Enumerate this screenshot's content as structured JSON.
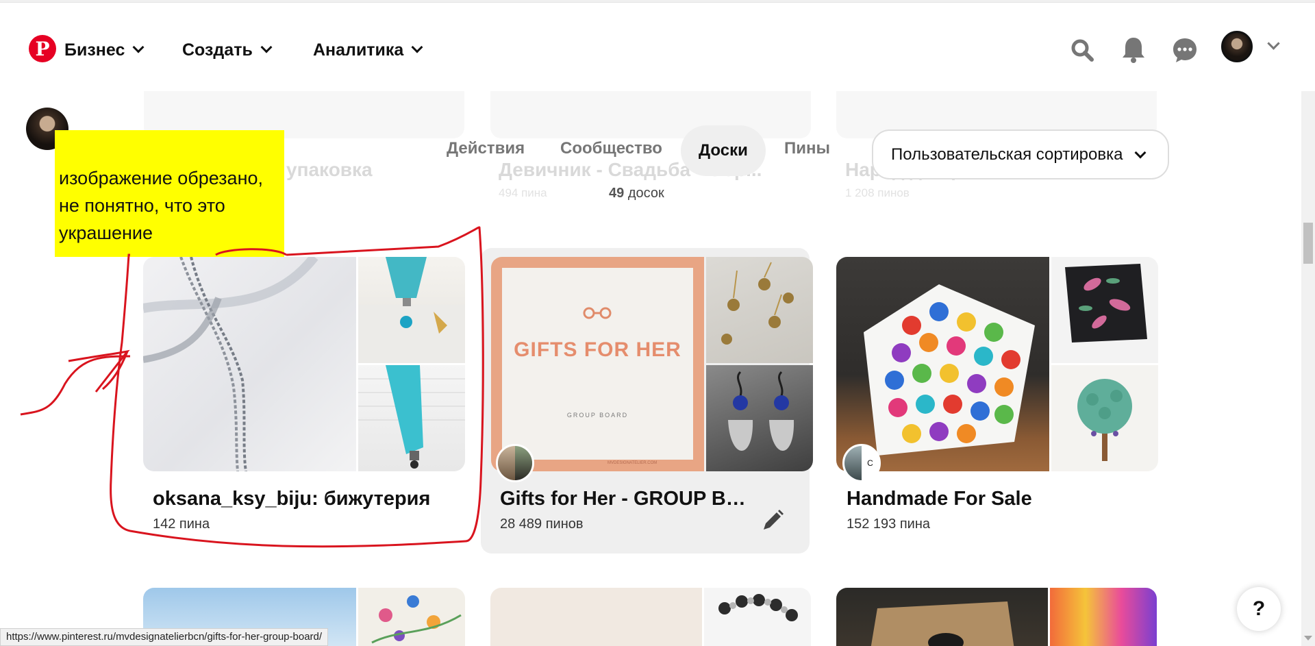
{
  "header": {
    "logo_letter": "P",
    "nav": [
      {
        "label": "Бизнес"
      },
      {
        "label": "Создать"
      },
      {
        "label": "Аналитика"
      }
    ],
    "icons": [
      "search-icon",
      "bell-icon",
      "chat-icon",
      "avatar",
      "chevron-down-icon"
    ]
  },
  "ghost_boards": [
    {
      "title": "упаковка",
      "sub": ""
    },
    {
      "title": "Девичник - Свадьба - Обр...",
      "sub": "494 пина"
    },
    {
      "title": "Наряд для работы",
      "sub": "1 208 пинов"
    }
  ],
  "tabs": [
    {
      "label": "Действия"
    },
    {
      "label": "Сообщество"
    },
    {
      "label": "Доски"
    },
    {
      "label": "Пины"
    }
  ],
  "sort": {
    "label": "Пользовательская сортировка"
  },
  "boards_count": {
    "number": "49",
    "label": "досок"
  },
  "annotation": {
    "text": "изображение обрезано, не понятно, что это украшение"
  },
  "boards": [
    {
      "title": "oksana_ksy_biju: бижутерия",
      "pins": "142 пина"
    },
    {
      "title": "Gifts for Her - GROUP BOARD",
      "pins": "28 489 пинов",
      "cover_text": "GIFTS FOR HER",
      "cover_sub": "GROUP BOARD",
      "cover_footer": "MVDESIGNATELIER.COM"
    },
    {
      "title": "Handmade For Sale",
      "pins": "152 193 пина",
      "collab_letter": "C"
    }
  ],
  "status_url": "https://www.pinterest.ru/mvdesignatelierbcn/gifts-for-her-group-board/",
  "help_label": "?",
  "colors": {
    "brand": "#e60023",
    "annotation": "#ffff00",
    "scribble": "#d9141e"
  }
}
